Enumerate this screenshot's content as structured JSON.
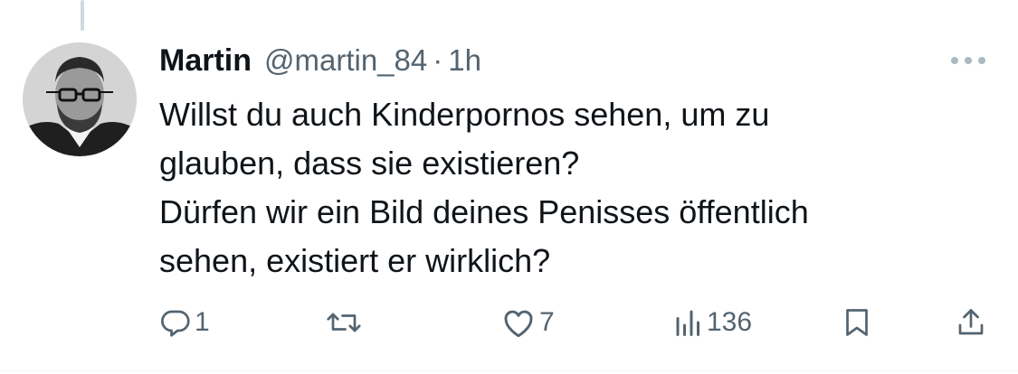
{
  "tweet": {
    "display_name": "Martin",
    "handle": "@martin_84",
    "separator": "·",
    "time": "1h",
    "text_lines": [
      "Willst du auch Kinderpornos sehen, um zu",
      "glauben, dass sie existieren?",
      "Dürfen wir ein Bild deines Penisses öffentlich",
      "sehen, existiert er wirklich?"
    ]
  },
  "actions": {
    "reply": {
      "icon": "reply-icon",
      "count": "1"
    },
    "retweet": {
      "icon": "retweet-icon",
      "count": ""
    },
    "like": {
      "icon": "heart-icon",
      "count": "7"
    },
    "views": {
      "icon": "views-icon",
      "count": "136"
    },
    "bookmark": {
      "icon": "bookmark-icon"
    },
    "share": {
      "icon": "share-icon"
    }
  },
  "colors": {
    "text_primary": "#0f1419",
    "text_secondary": "#536471",
    "thread_line": "#cfd9de"
  }
}
